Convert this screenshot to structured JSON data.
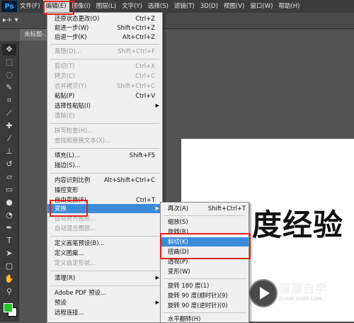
{
  "menubar": {
    "logo": "Ps",
    "items": [
      "文件(F)",
      "编辑(E)",
      "图像(I)",
      "图层(L)",
      "文字(Y)",
      "选择(S)",
      "滤镜(T)",
      "3D(D)",
      "视图(V)",
      "窗口(W)",
      "帮助(H)"
    ]
  },
  "optionsbar": {
    "tool_preset": "▸+ ▾"
  },
  "document": {
    "tab_label": "未标题-..."
  },
  "canvas": {
    "text": "度经验"
  },
  "watermark": {
    "name": "溜溜自学",
    "url": "ZIXUE.3D66.COM"
  },
  "edit_menu": {
    "items": [
      {
        "label": "还原状态更改(O)",
        "shortcut": "Ctrl+Z"
      },
      {
        "label": "前进一步(W)",
        "shortcut": "Shift+Ctrl+Z"
      },
      {
        "label": "后退一步(K)",
        "shortcut": "Alt+Ctrl+Z"
      },
      {
        "label": "渐隐(D)...",
        "shortcut": "Shift+Ctrl+F"
      },
      {
        "label": "剪切(T)",
        "shortcut": "Ctrl+X"
      },
      {
        "label": "拷贝(C)",
        "shortcut": "Ctrl+C"
      },
      {
        "label": "合并拷贝(Y)",
        "shortcut": "Shift+Ctrl+C"
      },
      {
        "label": "粘贴(P)",
        "shortcut": "Ctrl+V"
      },
      {
        "label": "选择性粘贴(I)",
        "shortcut": ""
      },
      {
        "label": "清除(E)",
        "shortcut": ""
      },
      {
        "label": "拼写检查(H)...",
        "shortcut": ""
      },
      {
        "label": "查找和替换文本(X)...",
        "shortcut": ""
      },
      {
        "label": "填充(L)...",
        "shortcut": "Shift+F5"
      },
      {
        "label": "描边(S)...",
        "shortcut": ""
      },
      {
        "label": "内容识别比例",
        "shortcut": "Alt+Shift+Ctrl+C"
      },
      {
        "label": "操控变形",
        "shortcut": ""
      },
      {
        "label": "自由变换(F)",
        "shortcut": "Ctrl+T"
      },
      {
        "label": "变换",
        "shortcut": ""
      },
      {
        "label": "自动对齐图层...",
        "shortcut": ""
      },
      {
        "label": "自动混合图层...",
        "shortcut": ""
      },
      {
        "label": "定义画笔预设(B)...",
        "shortcut": ""
      },
      {
        "label": "定义图案...",
        "shortcut": ""
      },
      {
        "label": "定义自定形状...",
        "shortcut": ""
      },
      {
        "label": "清理(R)",
        "shortcut": ""
      },
      {
        "label": "Adobe PDF 预设...",
        "shortcut": ""
      },
      {
        "label": "预设",
        "shortcut": ""
      },
      {
        "label": "远程连接...",
        "shortcut": ""
      }
    ]
  },
  "transform_menu": {
    "items": [
      {
        "label": "再次(A)",
        "shortcut": "Shift+Ctrl+T"
      },
      {
        "label": "缩放(S)"
      },
      {
        "label": "旋转(R)"
      },
      {
        "label": "斜切(K)"
      },
      {
        "label": "扭曲(D)"
      },
      {
        "label": "透视(P)"
      },
      {
        "label": "变形(W)"
      },
      {
        "label": "旋转 180 度(1)"
      },
      {
        "label": "旋转 90 度(顺时针)(9)"
      },
      {
        "label": "旋转 90 度(逆时针)(0)"
      },
      {
        "label": "水平翻转(H)"
      }
    ]
  },
  "colors": {
    "menubar": "#3c3c3c",
    "highlight": "#3b8bd9",
    "annotation": "#e42020",
    "foreground_swatch": "#22c52a"
  }
}
